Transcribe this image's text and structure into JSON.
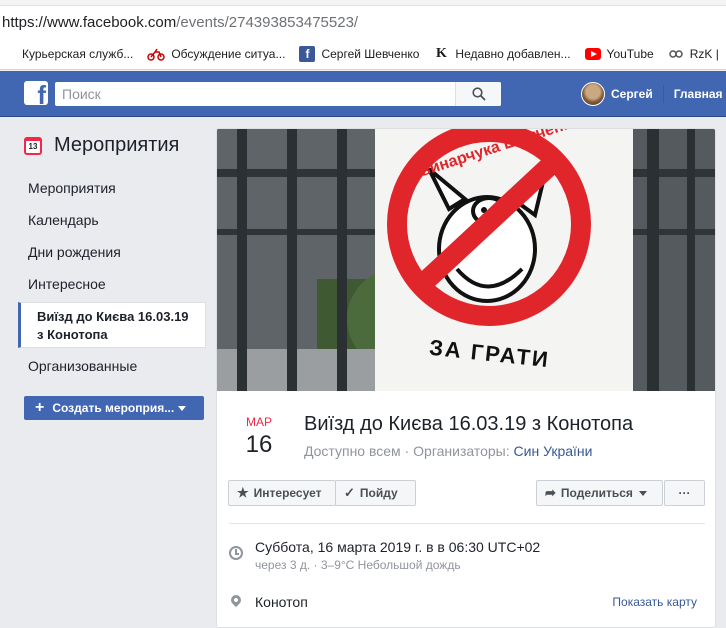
{
  "browser": {
    "url_host": "https://www.facebook.com",
    "url_path": "/events/274393853475523/",
    "bookmarks": [
      {
        "label": "Курьерская служб...",
        "icon": "page-icon"
      },
      {
        "label": "Обсуждение ситуа...",
        "icon": "motorbike-icon"
      },
      {
        "label": "Сергей Шевченко",
        "icon": "facebook-icon"
      },
      {
        "label": "Недавно добавлен...",
        "icon": "k-icon"
      },
      {
        "label": "YouTube",
        "icon": "youtube-icon"
      },
      {
        "label": "RzK |",
        "icon": "rzk-icon"
      }
    ]
  },
  "header": {
    "logo": "f",
    "search_placeholder": "Поиск",
    "user_name": "Сергей",
    "home_label": "Главная"
  },
  "leftnav": {
    "title": "Мероприятия",
    "calendar_day": "13",
    "items": [
      {
        "label": "Мероприятия",
        "active": false
      },
      {
        "label": "Календарь",
        "active": false
      },
      {
        "label": "Дни рождения",
        "active": false
      },
      {
        "label": "Интересное",
        "active": false
      },
      {
        "label": "Виїзд до Києва 16.03.19 з Конотопа",
        "active": true
      },
      {
        "label": "Организованные",
        "active": false
      }
    ],
    "create_label": "Создать мероприя..."
  },
  "event": {
    "cover_text_top": "#Свинарчука Шевченка",
    "cover_text_bottom": "ЗА ГРАТИ",
    "month": "МАР",
    "day": "16",
    "title": "Виїзд до Києва 16.03.19 з Конотопа",
    "privacy": "Доступно всем",
    "dot": "·",
    "organizers_label": "Организаторы:",
    "organizer": "Син України",
    "interested_label": "Интересует",
    "going_label": "Пойду",
    "share_label": "Поделиться",
    "more_label": "···",
    "datetime": "Суббота, 16 марта 2019 г. в в 06:30 UTC+02",
    "datetime_sub": "через 3 д. · 3–9°C Небольшой дождь",
    "location": "Конотоп",
    "map_link": "Показать карту"
  },
  "colors": {
    "fb_blue": "#4267b2",
    "link": "#365899",
    "month_red": "#f02849"
  }
}
